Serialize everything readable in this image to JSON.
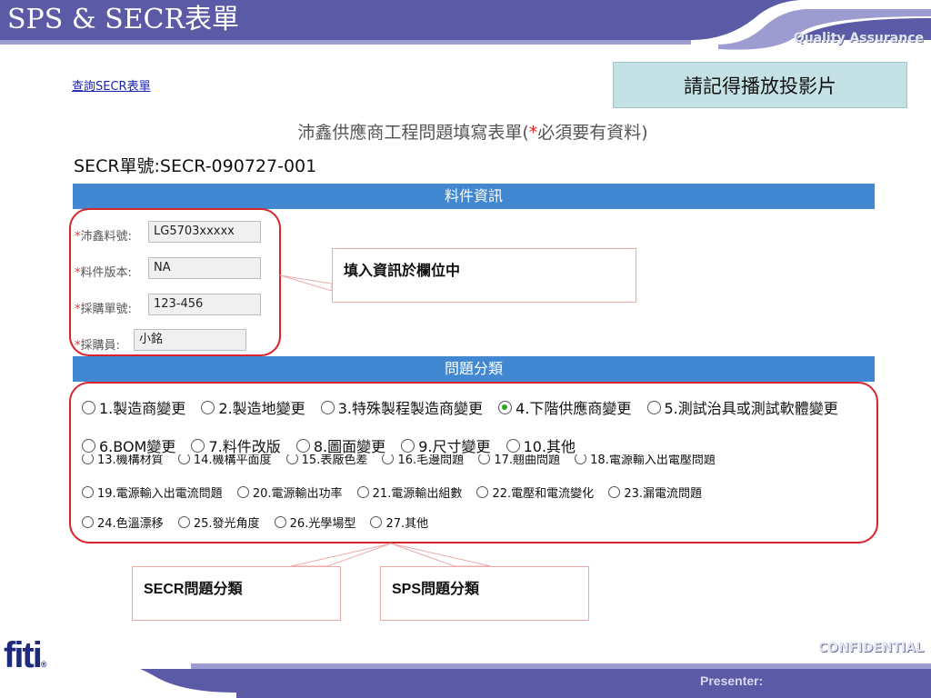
{
  "slide": {
    "title": "SPS & SECR表單",
    "quality_label": "Quality Assurance",
    "note": "請記得播放投影片",
    "confidential": "CONFIDENTIAL",
    "presenter": "Presenter:",
    "logo": "fiti",
    "logo_reg": "®"
  },
  "form": {
    "query_link": "查詢SECR表單",
    "title_main": "沛鑫供應商工程問題填寫表單(",
    "title_star": "*",
    "title_rest": "必須要有資料)",
    "secr_number": "SECR單號:SECR-090727-001",
    "section_item": "料件資訊",
    "section_problem": "問題分類",
    "required_mark": "*",
    "fields": [
      {
        "label": "沛鑫料號:",
        "value": "LG5703xxxxx"
      },
      {
        "label": "料件版本:",
        "value": "NA"
      },
      {
        "label": "採購單號:",
        "value": "123-456"
      },
      {
        "label": "採購員:",
        "value": "小銘"
      }
    ],
    "secr_categories_row1": [
      {
        "label": "1.製造商變更",
        "selected": false
      },
      {
        "label": "2.製造地變更",
        "selected": false
      },
      {
        "label": "3.特殊製程製造商變更",
        "selected": false
      },
      {
        "label": "4.下階供應商變更",
        "selected": true
      },
      {
        "label": "5.測試治具或測試軟體變更",
        "selected": false
      }
    ],
    "secr_categories_row2": [
      {
        "label": "6.BOM變更",
        "selected": false
      },
      {
        "label": "7.料件改版",
        "selected": false
      },
      {
        "label": "8.圖面變更",
        "selected": false
      },
      {
        "label": "9.尺寸變更",
        "selected": false
      },
      {
        "label": "10.其他",
        "selected": false
      }
    ],
    "sps_categories_cut": [
      "13.機構材質",
      "14.機構平面度",
      "15.表廠色差",
      "16.毛邊問題",
      "17.翹曲問題",
      "18.電源輸入出電壓問題"
    ],
    "sps_categories_row1": [
      "19.電源輸入出電流問題",
      "20.電源輸出功率",
      "21.電源輸出組數",
      "22.電壓和電流變化",
      "23.漏電流問題"
    ],
    "sps_categories_row2": [
      "24.色溫漂移",
      "25.發光角度",
      "26.光學場型",
      "27.其他"
    ]
  },
  "callouts": {
    "fill_info": "填入資訊於欄位中",
    "secr_prefix": "SECR",
    "secr_suffix": "問題分類",
    "sps_prefix": "SPS",
    "sps_suffix": "問題分類"
  },
  "colors": {
    "header_bar": "#5a5aa6",
    "section_bar": "#4187d2",
    "callout_border": "#d8232a",
    "note_bg": "#c4e2e6"
  }
}
